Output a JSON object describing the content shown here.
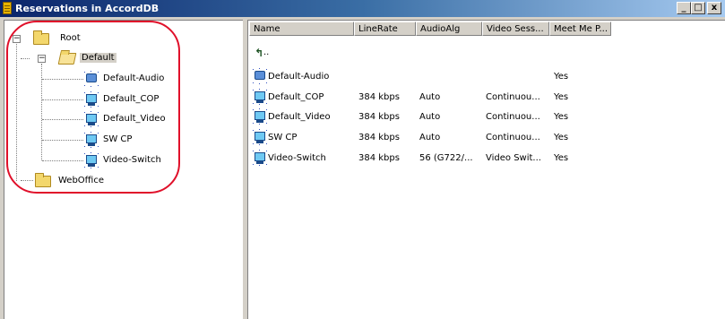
{
  "window": {
    "title": "Reservations in AccordDB",
    "title_icon": "database-icon",
    "buttons": {
      "minimize": "_",
      "maximize": "□",
      "close": "x"
    }
  },
  "tree": {
    "root": {
      "label": "Root",
      "icon": "folder-icon",
      "expander": "−"
    },
    "default": {
      "label": "Default",
      "icon": "open-folder-icon",
      "expander": "−",
      "selected": true
    },
    "children": [
      {
        "label": "Default-Audio",
        "icon": "audio-reservation-icon"
      },
      {
        "label": "Default_COP",
        "icon": "video-reservation-icon"
      },
      {
        "label": "Default_Video",
        "icon": "video-reservation-icon"
      },
      {
        "label": "SW CP",
        "icon": "video-reservation-icon"
      },
      {
        "label": "Video-Switch",
        "icon": "video-reservation-icon"
      }
    ],
    "weboffice": {
      "label": "WebOffice",
      "icon": "folder-icon"
    }
  },
  "list": {
    "columns": [
      "Name",
      "LineRate",
      "AudioAlg",
      "Video Sess...",
      "Meet Me P..."
    ],
    "up_row": {
      "label": "..",
      "icon": "up-folder-icon"
    },
    "rows": [
      {
        "name": "Default-Audio",
        "line_rate": "",
        "audio_alg": "",
        "video_session": "",
        "meet_me": "Yes"
      },
      {
        "name": "Default_COP",
        "line_rate": "384 kbps",
        "audio_alg": "Auto",
        "video_session": "Continuou...",
        "meet_me": "Yes"
      },
      {
        "name": "Default_Video",
        "line_rate": "384 kbps",
        "audio_alg": "Auto",
        "video_session": "Continuou...",
        "meet_me": "Yes"
      },
      {
        "name": "SW CP",
        "line_rate": "384 kbps",
        "audio_alg": "Auto",
        "video_session": "Continuou...",
        "meet_me": "Yes"
      },
      {
        "name": "Video-Switch",
        "line_rate": "384 kbps",
        "audio_alg": "56 (G722/...",
        "video_session": "Video Swit...",
        "meet_me": "Yes"
      }
    ]
  },
  "colors": {
    "titlebar_start": "#0a246a",
    "titlebar_end": "#a6caf0",
    "annotation_circle": "#e0102a",
    "selection": "#d4d0c8"
  }
}
